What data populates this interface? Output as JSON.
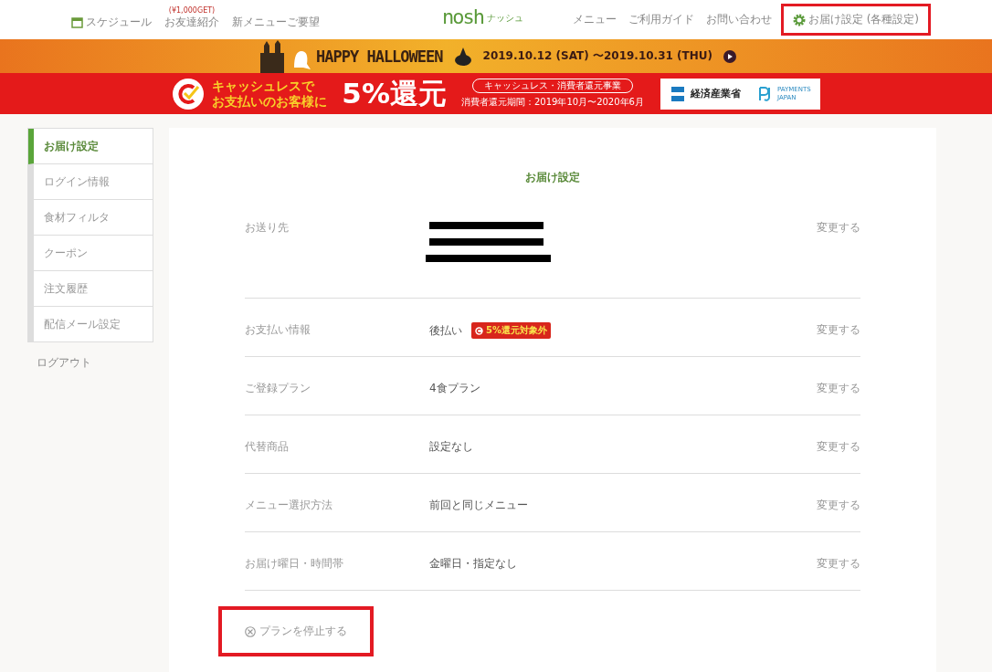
{
  "header": {
    "left_nav": [
      {
        "kind": "calendar",
        "label": "スケジュール",
        "highlighted": false
      },
      {
        "kind": "plain",
        "label": "お友達紹介",
        "badge": "(¥1,000GET)",
        "highlighted": false
      },
      {
        "kind": "plain",
        "label": "新メニューご要望",
        "highlighted": false
      }
    ],
    "logo": {
      "name": "nosh",
      "sub": "ナッシュ"
    },
    "right_nav": [
      {
        "kind": "plain",
        "label": "メニュー",
        "highlighted": false
      },
      {
        "kind": "plain",
        "label": "ご利用ガイド",
        "highlighted": false
      },
      {
        "kind": "plain",
        "label": "お問い合わせ",
        "highlighted": false
      },
      {
        "kind": "gear",
        "label": "お届け設定 (各種設定)",
        "highlighted": true
      }
    ]
  },
  "halloween_banner": {
    "title": "HAPPY HALLOWEEN",
    "dates": "2019.10.12 (SAT) 〜2019.10.31 (THU)"
  },
  "cashless_banner": {
    "line1": "キャッシュレスで",
    "line2": "お支払いのお客様に",
    "headline": "5%還元",
    "program": "キャッシュレス・消費者還元事業",
    "period": "消費者還元期間：2019年10月〜2020年6月",
    "ministry": "経済産業省",
    "partner_1": "PAYMENTS",
    "partner_2": "JAPAN"
  },
  "sidebar": {
    "items": [
      {
        "label": "お届け設定",
        "selected": true
      },
      {
        "label": "ログイン情報",
        "selected": false
      },
      {
        "label": "食材フィルタ",
        "selected": false
      },
      {
        "label": "クーポン",
        "selected": false
      },
      {
        "label": "注文履歴",
        "selected": false
      },
      {
        "label": "配信メール設定",
        "selected": false
      }
    ],
    "logout": "ログアウト"
  },
  "main": {
    "title": "お届け設定",
    "rows": [
      {
        "kind": "redacted",
        "label": "お送り先",
        "action": "変更する"
      },
      {
        "kind": "text",
        "label": "お支払い情報",
        "value": "後払い",
        "badge": "5%還元対象外",
        "action": "変更する"
      },
      {
        "kind": "text",
        "label": "ご登録プラン",
        "value": "4食プラン",
        "action": "変更する"
      },
      {
        "kind": "text",
        "label": "代替商品",
        "value": "設定なし",
        "action": "変更する"
      },
      {
        "kind": "text",
        "label": "メニュー選択方法",
        "value": "前回と同じメニュー",
        "action": "変更する"
      },
      {
        "kind": "text",
        "label": "お届け曜日・時間帯",
        "value": "金曜日・指定なし",
        "action": "変更する"
      }
    ],
    "stop_plan": {
      "label": "プランを停止する",
      "highlighted": true
    }
  }
}
